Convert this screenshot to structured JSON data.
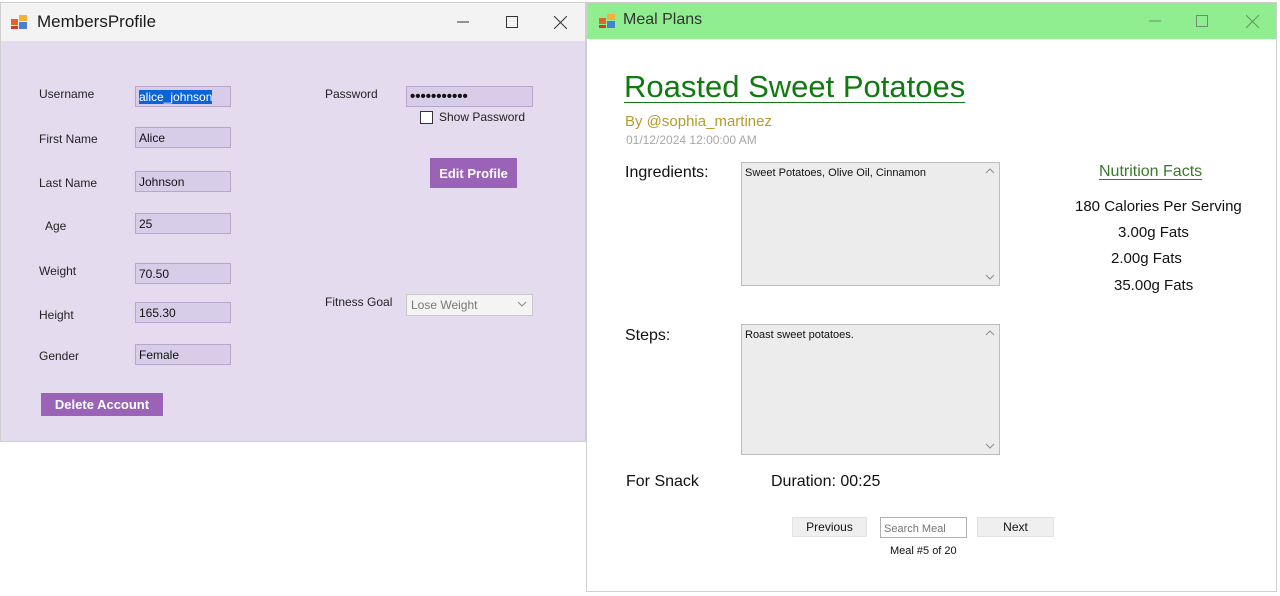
{
  "profile_window": {
    "title": "MembersProfile",
    "controls": {
      "minimize": "—",
      "maximize": "☐",
      "close": "✕"
    },
    "username": {
      "label": "Username",
      "value": "alice_johnson"
    },
    "first_name": {
      "label": "First Name",
      "value": "Alice"
    },
    "last_name": {
      "label": "Last Name",
      "value": "Johnson"
    },
    "age": {
      "label": "Age",
      "value": "25"
    },
    "weight": {
      "label": "Weight",
      "value": "70.50"
    },
    "height": {
      "label": "Height",
      "value": "165.30"
    },
    "gender": {
      "label": "Gender",
      "value": "Female"
    },
    "password": {
      "label": "Password",
      "value": "•••••••••••"
    },
    "show_password_label": "Show Password",
    "show_password_checked": false,
    "edit_profile_label": "Edit Profile",
    "fitness_goal": {
      "label": "Fitness Goal",
      "value": "Lose Weight"
    },
    "delete_account_label": "Delete Account",
    "accent_color": "#9a63b8",
    "background_color": "#e4dcee"
  },
  "meal_window": {
    "title": "Meal Plans",
    "controls": {
      "minimize": "—",
      "maximize": "☐",
      "close": "✕"
    },
    "titlebar_color": "#90ee90",
    "meal_name": "Roasted Sweet Potatoes",
    "author": "By @sophia_martinez",
    "date": "01/12/2024 12:00:00 AM",
    "ingredients_label": "Ingredients:",
    "ingredients_text": "Sweet Potatoes, Olive Oil, Cinnamon",
    "steps_label": "Steps:",
    "steps_text": "Roast sweet potatoes.",
    "nutrition": {
      "heading": "Nutrition Facts",
      "calories": "180 Calories Per Serving",
      "line1": "3.00g Fats",
      "line2": "2.00g Fats",
      "line3": "35.00g Fats"
    },
    "meal_type": "For Snack",
    "duration": "Duration:  00:25",
    "previous_label": "Previous",
    "next_label": "Next",
    "search_placeholder": "Search Meal",
    "counter": "Meal #5 of 20"
  }
}
